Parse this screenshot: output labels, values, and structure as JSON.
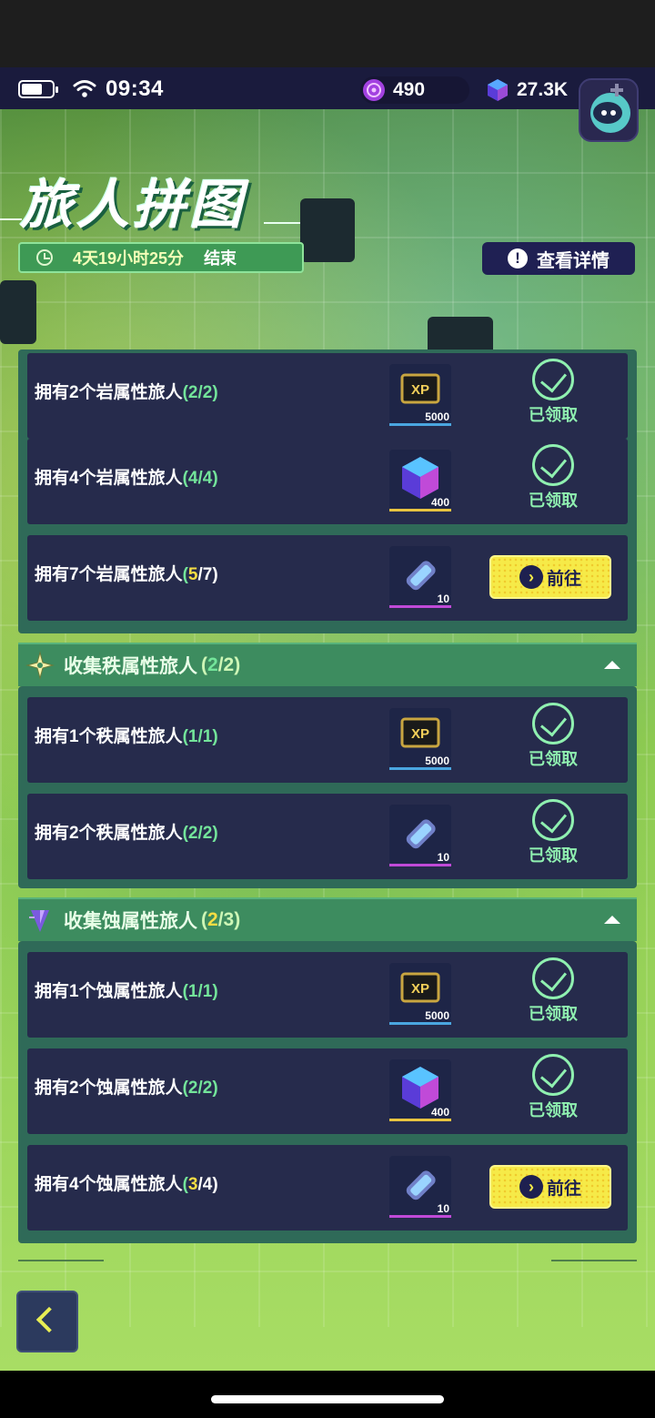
{
  "status_bar": {
    "time": "09:34"
  },
  "resources": [
    {
      "icon": "purple-gem-icon",
      "value": "490"
    },
    {
      "icon": "blue-cube-icon",
      "value": "27.3K"
    }
  ],
  "header": {
    "title": "旅人拼图",
    "timer": "4天19小时25分",
    "timer_suffix": "结束",
    "details_label": "查看详情"
  },
  "sections": [
    {
      "rows": [
        {
          "label": "拥有2个岩属性旅人",
          "progress_open": "(",
          "progress_cur": "2",
          "progress_rest": "/2)",
          "reward": "xp-chip-icon",
          "qty": "5000",
          "state": "claimed"
        },
        {
          "label": "拥有4个岩属性旅人",
          "progress_open": "(",
          "progress_cur": "4",
          "progress_rest": "/4)",
          "reward": "blue-cube-icon",
          "qty": "400",
          "state": "claimed"
        },
        {
          "label": "拥有7个岩属性旅人",
          "progress_open": "(",
          "progress_cur": "5",
          "progress_rest": "/7)",
          "reward": "ticket-icon",
          "qty": "10",
          "state": "go"
        }
      ]
    },
    {
      "title": "收集秩属性旅人",
      "count_open": "(",
      "count_cur": "2",
      "count_rest": "/2)",
      "rows": [
        {
          "label": "拥有1个秩属性旅人",
          "progress_open": "(",
          "progress_cur": "1",
          "progress_rest": "/1)",
          "reward": "xp-chip-icon",
          "qty": "5000",
          "state": "claimed"
        },
        {
          "label": "拥有2个秩属性旅人",
          "progress_open": "(",
          "progress_cur": "2",
          "progress_rest": "/2)",
          "reward": "ticket-icon",
          "qty": "10",
          "state": "claimed"
        }
      ]
    },
    {
      "title": "收集蚀属性旅人",
      "count_open": "(",
      "count_cur": "2",
      "count_rest": "/3)",
      "rows": [
        {
          "label": "拥有1个蚀属性旅人",
          "progress_open": "(",
          "progress_cur": "1",
          "progress_rest": "/1)",
          "reward": "xp-chip-icon",
          "qty": "5000",
          "state": "claimed"
        },
        {
          "label": "拥有2个蚀属性旅人",
          "progress_open": "(",
          "progress_cur": "2",
          "progress_rest": "/2)",
          "reward": "blue-cube-icon",
          "qty": "400",
          "state": "claimed"
        },
        {
          "label": "拥有4个蚀属性旅人",
          "progress_open": "(",
          "progress_cur": "3",
          "progress_rest": "/4)",
          "reward": "ticket-icon",
          "qty": "10",
          "state": "go"
        }
      ]
    }
  ],
  "labels": {
    "claimed": "已领取",
    "go": "前往",
    "xp": "XP"
  },
  "colors": {
    "progress_done": "#73e49a",
    "progress_pending": "#f5dd44",
    "go_button": "#f6ea48"
  }
}
